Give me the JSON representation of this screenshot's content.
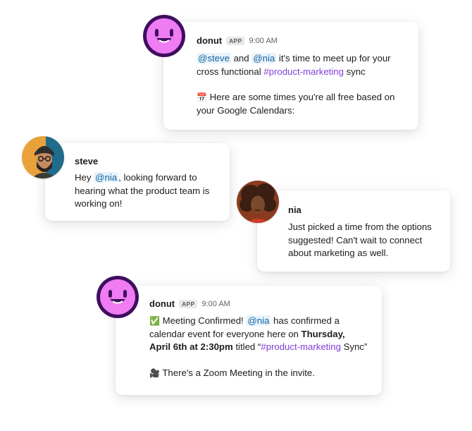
{
  "messages": [
    {
      "author": "donut",
      "badge": "APP",
      "time": "9:00 AM",
      "mention1": "@steve",
      "and": " and ",
      "mention2": "@nia",
      "text1": " it's time to meet up for your cross functional ",
      "channel": "#product-marketing",
      "text2": " sync",
      "calendar_emoji": "📅",
      "text3": " Here are some times you're all free based on your Google Calendars:"
    },
    {
      "author": "steve",
      "pre": "Hey ",
      "mention": "@nia",
      "text": ", looking forward to hearing what the product team is working on!"
    },
    {
      "author": "nia",
      "text": "Just picked a time from the options suggested! Can't wait to connect about marketing as well."
    },
    {
      "author": "donut",
      "badge": "APP",
      "time": "9:00 AM",
      "check_emoji": "✅",
      "text1": " Meeting Confirmed! ",
      "mention": "@nia",
      "text2": " has confirmed a calendar event for everyone here on ",
      "datetime": "Thursday, April 6th at 2:30pm",
      "text3": " titled “",
      "channel": "#product-marketing",
      "text4": " Sync”",
      "camera_emoji": "🎥",
      "text5": " There's a Zoom Meeting in the invite."
    }
  ],
  "colors": {
    "donut_face": "#ef7cf2",
    "donut_ring": "#3f0e5e",
    "mention_bg": "#e8f3fb",
    "mention_text": "#1264a3",
    "channel_text": "#7e3ed8"
  }
}
